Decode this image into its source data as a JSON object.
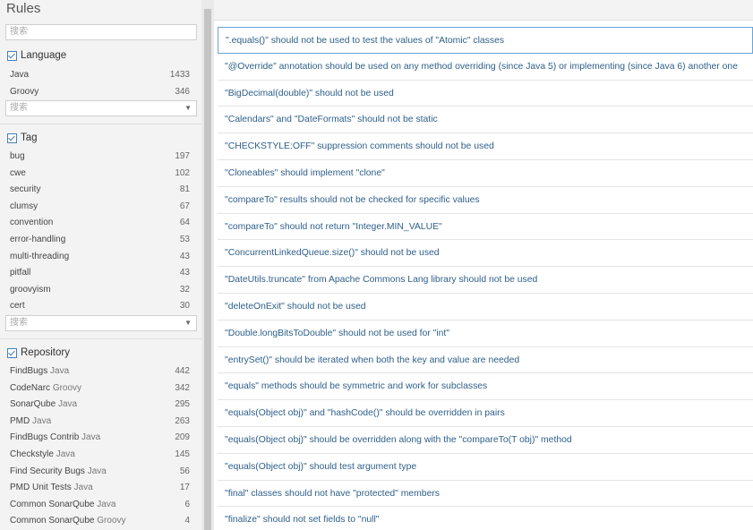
{
  "sidebar": {
    "title": "Rules",
    "search_placeholder": "搜索",
    "language": {
      "label": "Language",
      "items": [
        {
          "name": "Java",
          "sub": "",
          "count": "1433"
        },
        {
          "name": "Groovy",
          "sub": "",
          "count": "346"
        }
      ],
      "search_placeholder": "搜索"
    },
    "tag": {
      "label": "Tag",
      "items": [
        {
          "name": "bug",
          "sub": "",
          "count": "197"
        },
        {
          "name": "cwe",
          "sub": "",
          "count": "102"
        },
        {
          "name": "security",
          "sub": "",
          "count": "81"
        },
        {
          "name": "clumsy",
          "sub": "",
          "count": "67"
        },
        {
          "name": "convention",
          "sub": "",
          "count": "64"
        },
        {
          "name": "error-handling",
          "sub": "",
          "count": "53"
        },
        {
          "name": "multi-threading",
          "sub": "",
          "count": "43"
        },
        {
          "name": "pitfall",
          "sub": "",
          "count": "43"
        },
        {
          "name": "groovyism",
          "sub": "",
          "count": "32"
        },
        {
          "name": "cert",
          "sub": "",
          "count": "30"
        }
      ],
      "search_placeholder": "搜索"
    },
    "repository": {
      "label": "Repository",
      "items": [
        {
          "name": "FindBugs",
          "sub": "Java",
          "count": "442"
        },
        {
          "name": "CodeNarc",
          "sub": "Groovy",
          "count": "342"
        },
        {
          "name": "SonarQube",
          "sub": "Java",
          "count": "295"
        },
        {
          "name": "PMD",
          "sub": "Java",
          "count": "263"
        },
        {
          "name": "FindBugs Contrib",
          "sub": "Java",
          "count": "209"
        },
        {
          "name": "Checkstyle",
          "sub": "Java",
          "count": "145"
        },
        {
          "name": "Find Security Bugs",
          "sub": "Java",
          "count": "56"
        },
        {
          "name": "PMD Unit Tests",
          "sub": "Java",
          "count": "17"
        },
        {
          "name": "Common SonarQube",
          "sub": "Java",
          "count": "6"
        },
        {
          "name": "Common SonarQube",
          "sub": "Groovy",
          "count": "4"
        }
      ]
    }
  },
  "rules": [
    "\".equals()\" should not be used to test the values of \"Atomic\" classes",
    "\"@Override\" annotation should be used on any method overriding (since Java 5) or implementing (since Java 6) another one",
    "\"BigDecimal(double)\" should not be used",
    "\"Calendars\" and \"DateFormats\" should not be static",
    "\"CHECKSTYLE:OFF\" suppression comments should not be used",
    "\"Cloneables\" should implement \"clone\"",
    "\"compareTo\" results should not be checked for specific values",
    "\"compareTo\" should not return \"Integer.MIN_VALUE\"",
    "\"ConcurrentLinkedQueue.size()\" should not be used",
    "\"DateUtils.truncate\" from Apache Commons Lang library should not be used",
    "\"deleteOnExit\" should not be used",
    "\"Double.longBitsToDouble\" should not be used for \"int\"",
    "\"entrySet()\" should be iterated when both the key and value are needed",
    "\"equals\" methods should be symmetric and work for subclasses",
    "\"equals(Object obj)\" and \"hashCode()\" should be overridden in pairs",
    "\"equals(Object obj)\" should be overridden along with the \"compareTo(T obj)\" method",
    "\"equals(Object obj)\" should test argument type",
    "\"final\" classes should not have \"protected\" members",
    "\"finalize\" should not set fields to \"null\""
  ],
  "colors": {
    "link": "#2e5f8a",
    "selected_border": "#68a5d6",
    "checkbox": "#4a7fb5"
  }
}
